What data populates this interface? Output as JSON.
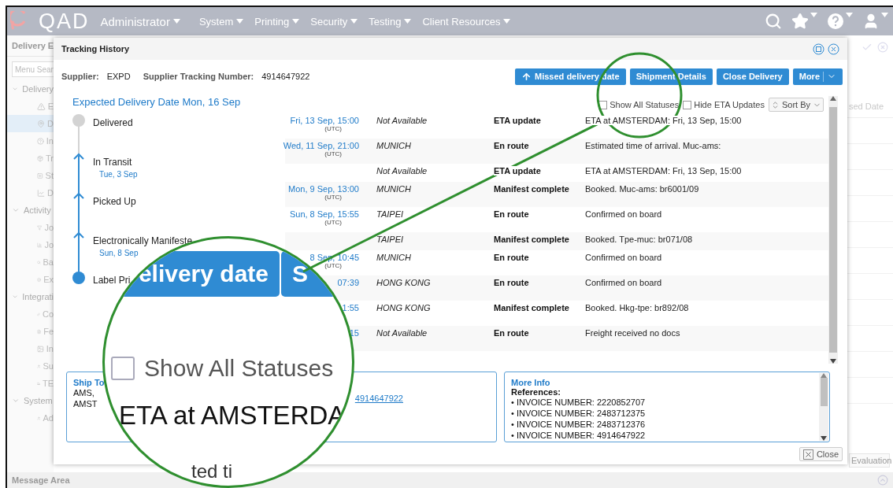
{
  "header": {
    "logo": "QAD",
    "user_menu": "Administrator",
    "menus": [
      "System",
      "Printing",
      "Security",
      "Testing",
      "Client Resources"
    ]
  },
  "background": {
    "panel_title": "Delivery E",
    "search": {
      "placeholder": "Menu Sear"
    },
    "groups": [
      {
        "label": "Delivery",
        "items": [
          {
            "kind": "warning",
            "label": "E",
            "selected": false
          },
          {
            "kind": "pin",
            "label": "D",
            "selected": true
          },
          {
            "kind": "question",
            "label": "In",
            "selected": false
          },
          {
            "kind": "box",
            "label": "Tr",
            "selected": false
          },
          {
            "kind": "square-plus",
            "label": "St",
            "selected": false
          },
          {
            "kind": "line-chart",
            "label": "D",
            "selected": false
          }
        ]
      },
      {
        "label": "Activity",
        "items": [
          {
            "kind": "funnel",
            "label": "Jo",
            "selected": false
          },
          {
            "kind": "bar-chart",
            "label": "Jo",
            "selected": false
          },
          {
            "kind": "search",
            "label": "Ba",
            "selected": false
          },
          {
            "kind": "download",
            "label": "Ex",
            "selected": false
          }
        ]
      },
      {
        "label": "Integrati",
        "items": [
          {
            "kind": "link",
            "label": "Co",
            "selected": false
          },
          {
            "kind": "document",
            "label": "Fe",
            "selected": false
          },
          {
            "kind": "image",
            "label": "In",
            "selected": false
          },
          {
            "kind": "user",
            "label": "Su",
            "selected": false
          },
          {
            "kind": "truck",
            "label": "TE",
            "selected": false
          }
        ]
      },
      {
        "label": "System",
        "items": [
          {
            "kind": "user",
            "label": "Ad",
            "selected": false
          }
        ]
      }
    ],
    "column_header": "sed Date",
    "evaluation_button": "Evaluation",
    "message_area": "Message Area"
  },
  "dialog": {
    "title": "Tracking History",
    "supplier_label": "Supplier:",
    "supplier": "EXPD",
    "tracking_label": "Supplier Tracking Number:",
    "tracking_number": "4914647922",
    "buttons": [
      {
        "kind": "arrow",
        "label": "Missed delivery date"
      },
      {
        "kind": "plain",
        "label": "Shipment Details"
      },
      {
        "kind": "plain",
        "label": "Close Delivery"
      },
      {
        "kind": "split",
        "label": "More"
      }
    ],
    "expected": "Expected Delivery Date Mon, 16 Sep",
    "timeline": [
      {
        "kind": "pending",
        "label": "Delivered"
      },
      {
        "kind": "passed",
        "label": "In Transit",
        "date": "Tue, 3 Sep"
      },
      {
        "kind": "passed",
        "label": "Picked Up"
      },
      {
        "kind": "passed",
        "label": "Electronically Manifeste",
        "date": "Sun, 8 Sep"
      },
      {
        "kind": "current",
        "label": "Label Pri"
      }
    ],
    "filters": [
      {
        "label": "Show All Statuses",
        "checked": false
      },
      {
        "label": "Hide ETA Updates",
        "checked": false
      }
    ],
    "sort": "Sort By",
    "events": [
      {
        "date": "Fri, 13 Sep, 15:00",
        "zone": "(UTC)",
        "location": "Not Available",
        "status": "ETA update",
        "description": "ETA at AMSTERDAM: Fri, 13 Sep, 15:00"
      },
      {
        "date": "Wed, 11 Sep, 21:00",
        "zone": "(UTC)",
        "location": "MUNICH",
        "status": "En route",
        "description": "Estimated time of arrival. Muc-ams:"
      },
      {
        "location": "Not Available",
        "status": "ETA update",
        "description": "ETA at AMSTERDAM: Fri, 13 Sep, 15:00"
      },
      {
        "date": "Mon, 9 Sep, 13:00",
        "zone": "(UTC)",
        "location": "MUNICH",
        "status": "Manifest complete",
        "description": "Booked. Muc-ams: br6001/09"
      },
      {
        "date": "Sun, 8 Sep, 15:55",
        "zone": "(UTC)",
        "location": "TAIPEI",
        "status": "En route",
        "description": "Confirmed on board"
      },
      {
        "location": "TAIPEI",
        "status": "Manifest complete",
        "description": "Booked. Tpe-muc: br071/08"
      },
      {
        "date": "8 Sep, 10:45",
        "zone": "(UTC)",
        "location": "MUNICH",
        "status": "En route",
        "description": "Confirmed on board"
      },
      {
        "date": "07:39",
        "location": "HONG KONG",
        "status": "En route",
        "description": "Confirmed on board"
      },
      {
        "date": "1:55",
        "location": "HONG KONG",
        "status": "Manifest complete",
        "description": "Booked. Hkg-tpe: br892/08"
      },
      {
        "date": "15",
        "location": "Not Available",
        "status": "En route",
        "description": "Freight received no docs"
      }
    ],
    "ship_to": {
      "title": "Ship To",
      "lines": [
        "AMS,",
        "AMST"
      ],
      "link": "4914647922"
    },
    "more_info": {
      "title": "More Info",
      "subtitle": "References:",
      "lines": [
        "• INVOICE NUMBER: 2220852707",
        "• INVOICE NUMBER: 2483712375",
        "• INVOICE NUMBER: 2483712376",
        "• INVOICE NUMBER: 4914647922"
      ]
    },
    "close": "Close"
  },
  "magnifier": {
    "button_text": "elivery date",
    "button_text_2": "S",
    "checkbox": {
      "label": "Show All Statuses",
      "checked": false
    },
    "text": "ETA at AMSTERDA",
    "bottom_text": "ted ti"
  }
}
